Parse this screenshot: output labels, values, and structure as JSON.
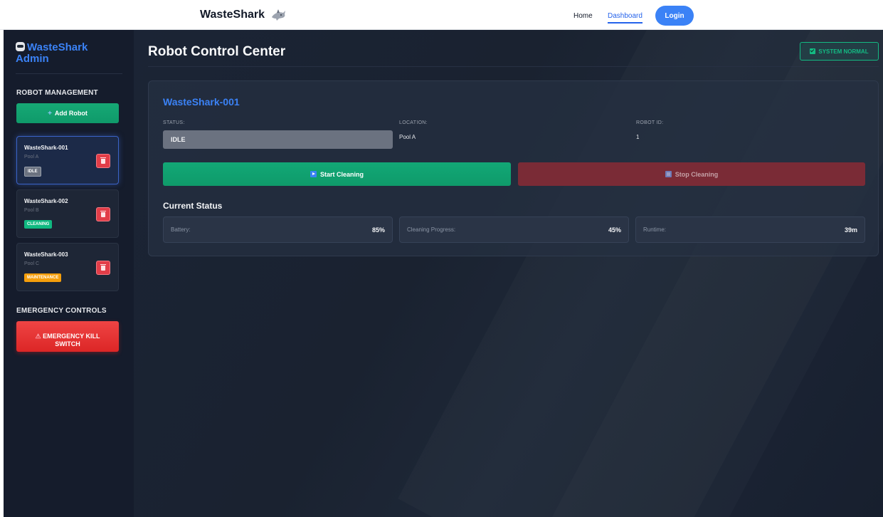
{
  "nav": {
    "brand": "WasteShark",
    "home": "Home",
    "dashboard": "Dashboard",
    "login": "Login"
  },
  "sidebar": {
    "title": "WasteShark Admin",
    "robot_management": "ROBOT MANAGEMENT",
    "add_robot": "Add Robot",
    "robots": [
      {
        "name": "WasteShark-001",
        "pool": "Pool A",
        "status": "IDLE",
        "status_color": "#6b7280",
        "selected": true
      },
      {
        "name": "WasteShark-002",
        "pool": "Pool B",
        "status": "CLEANING",
        "status_color": "#10b981",
        "selected": false
      },
      {
        "name": "WasteShark-003",
        "pool": "Pool C",
        "status": "MAINTENANCE",
        "status_color": "#f59e0b",
        "selected": false
      }
    ],
    "emergency_controls": "EMERGENCY CONTROLS",
    "kill_switch_line1": "EMERGENCY KILL",
    "kill_switch_line2": "SWITCH"
  },
  "main": {
    "title": "Robot Control Center",
    "system_status": "SYSTEM NORMAL",
    "robot": {
      "name": "WasteShark-001",
      "status_label": "STATUS:",
      "status": "IDLE",
      "location_label": "LOCATION:",
      "location": "Pool A",
      "id_label": "ROBOT ID:",
      "id": "1"
    },
    "start_cleaning": "Start Cleaning",
    "stop_cleaning": "Stop Cleaning",
    "current_status": "Current Status",
    "metrics": {
      "battery_label": "Battery:",
      "battery": "85%",
      "progress_label": "Cleaning Progress:",
      "progress": "45%",
      "runtime_label": "Runtime:",
      "runtime": "39m"
    }
  },
  "colors": {
    "accent": "#3b82f6",
    "success": "#10b981",
    "danger": "#dc2626",
    "warning": "#f59e0b"
  }
}
